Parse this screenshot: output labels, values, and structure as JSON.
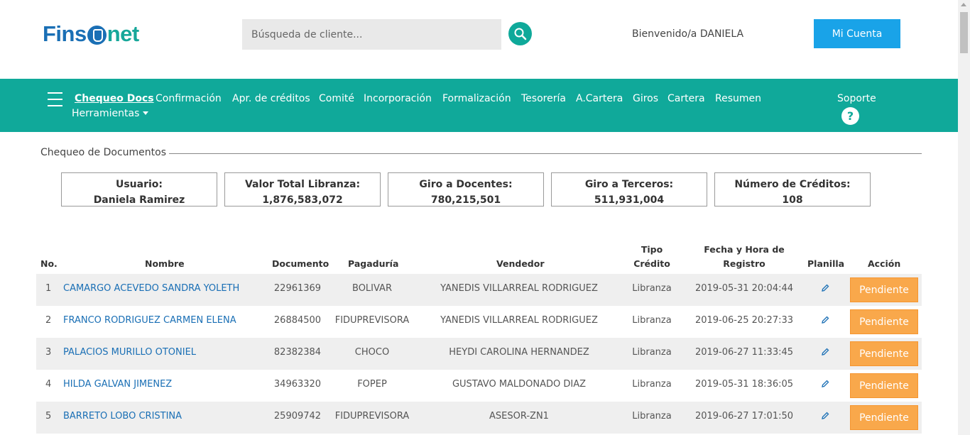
{
  "header": {
    "logo_part1": "Fins",
    "logo_part2": "net",
    "search_placeholder": "Búsqueda de cliente...",
    "welcome": "Bienvenido/a DANIELA",
    "account_label": "Mi Cuenta"
  },
  "nav": {
    "items": [
      "Chequeo Docs",
      "Confirmación",
      "Apr. de créditos",
      "Comité",
      "Incorporación",
      "Formalización",
      "Tesorería",
      "A.Cartera",
      "Giros",
      "Cartera",
      "Resumen"
    ],
    "tools": "Herramientas",
    "support": "Soporte",
    "help_glyph": "?"
  },
  "section": {
    "title": "Chequeo de Documentos"
  },
  "stats": [
    {
      "label": "Usuario:",
      "value": "Daniela Ramirez"
    },
    {
      "label": "Valor Total Libranza:",
      "value": "1,876,583,072"
    },
    {
      "label": "Giro a Docentes:",
      "value": "780,215,501"
    },
    {
      "label": "Giro a Terceros:",
      "value": "511,931,004"
    },
    {
      "label": "Número de Créditos:",
      "value": "108"
    }
  ],
  "table": {
    "headers": {
      "no": "No.",
      "nombre": "Nombre",
      "documento": "Documento",
      "pagaduria": "Pagaduría",
      "vendedor": "Vendedor",
      "tipo_1": "Tipo",
      "tipo_2": "Crédito",
      "fecha_1": "Fecha y Hora de",
      "fecha_2": "Registro",
      "planilla": "Planilla",
      "accion": "Acción"
    },
    "rows": [
      {
        "no": "1",
        "nombre": "CAMARGO ACEVEDO SANDRA YOLETH",
        "documento": "22961369",
        "pagaduria": "BOLIVAR",
        "vendedor": "YANEDIS VILLARREAL RODRIGUEZ",
        "tipo": "Libranza",
        "fecha": "2019-05-31 20:04:44",
        "accion": "Pendiente"
      },
      {
        "no": "2",
        "nombre": "FRANCO RODRIGUEZ CARMEN ELENA",
        "documento": "26884500",
        "pagaduria": "FIDUPREVISORA",
        "vendedor": "YANEDIS VILLARREAL RODRIGUEZ",
        "tipo": "Libranza",
        "fecha": "2019-06-25 20:27:33",
        "accion": "Pendiente"
      },
      {
        "no": "3",
        "nombre": "PALACIOS MURILLO OTONIEL",
        "documento": "82382384",
        "pagaduria": "CHOCO",
        "vendedor": "HEYDI CAROLINA HERNANDEZ",
        "tipo": "Libranza",
        "fecha": "2019-06-27 11:33:45",
        "accion": "Pendiente"
      },
      {
        "no": "4",
        "nombre": "HILDA GALVAN JIMENEZ",
        "documento": "34963320",
        "pagaduria": "FOPEP",
        "vendedor": "GUSTAVO MALDONADO DIAZ",
        "tipo": "Libranza",
        "fecha": "2019-05-31 18:36:05",
        "accion": "Pendiente"
      },
      {
        "no": "5",
        "nombre": "BARRETO LOBO CRISTINA",
        "documento": "25909742",
        "pagaduria": "FIDUPREVISORA",
        "vendedor": "ASESOR-ZN1",
        "tipo": "Libranza",
        "fecha": "2019-06-27 17:01:50",
        "accion": "Pendiente"
      }
    ]
  },
  "colors": {
    "teal": "#10a99a",
    "blue": "#1a6fb5",
    "button_blue": "#19a3e8",
    "pending_orange": "#f9a84b"
  }
}
